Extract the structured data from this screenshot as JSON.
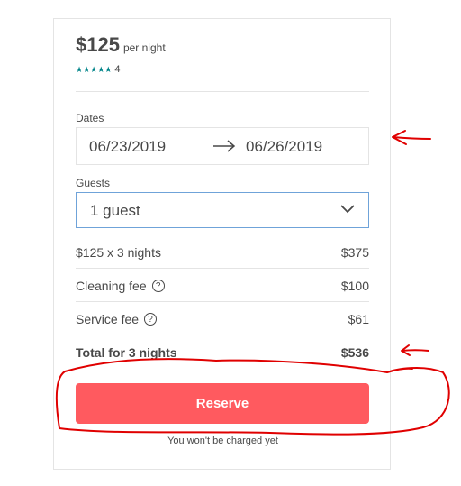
{
  "listing": {
    "price": "$125",
    "per_night": "per night",
    "stars": "★★★★★",
    "rating_count": "4"
  },
  "dates": {
    "label": "Dates",
    "check_in": "06/23/2019",
    "check_out": "06/26/2019"
  },
  "guests": {
    "label": "Guests",
    "value": "1 guest"
  },
  "fees": [
    {
      "label": "$125 x 3 nights",
      "value": "$375"
    },
    {
      "label": "Cleaning fee",
      "value": "$100"
    },
    {
      "label": "Service fee",
      "value": "$61"
    },
    {
      "label": "Total for 3 nights",
      "value": "$536"
    }
  ],
  "help_glyph": "?",
  "reserve": {
    "label": "Reserve",
    "note": "You won't be charged yet"
  },
  "colors": {
    "accent": "#ff5a5f",
    "stars": "#008489",
    "annotation": "#e00000"
  }
}
